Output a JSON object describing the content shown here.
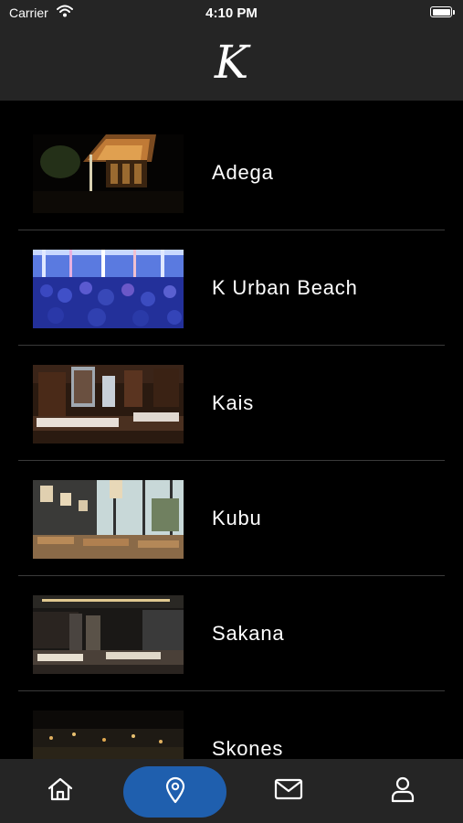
{
  "status_bar": {
    "carrier": "Carrier",
    "time": "4:10 PM"
  },
  "header": {
    "logo": "K"
  },
  "venues": [
    {
      "name": "Adega"
    },
    {
      "name": "K Urban Beach"
    },
    {
      "name": "Kais"
    },
    {
      "name": "Kubu"
    },
    {
      "name": "Sakana"
    },
    {
      "name": "Skones"
    }
  ],
  "tabbar": {
    "items": [
      {
        "icon": "home-icon",
        "active": false
      },
      {
        "icon": "location-pin-icon",
        "active": true
      },
      {
        "icon": "mail-icon",
        "active": false
      },
      {
        "icon": "user-icon",
        "active": false
      }
    ],
    "active_color": "#1f5fae"
  }
}
